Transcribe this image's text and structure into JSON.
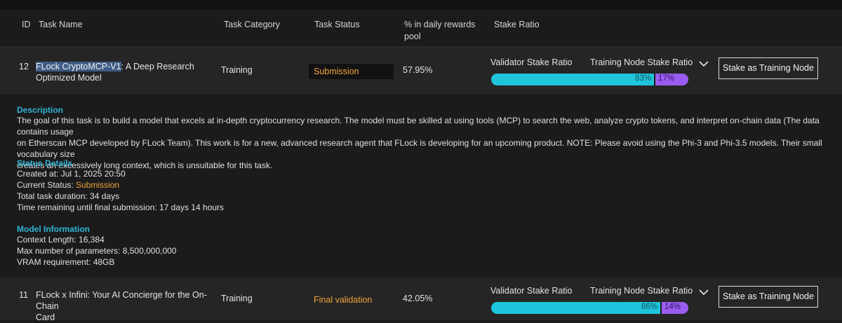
{
  "table": {
    "headers": {
      "id": "ID",
      "task_name": "Task Name",
      "task_category": "Task Category",
      "task_status": "Task Status",
      "rewards_line1": "% in daily rewards",
      "rewards_line2": "pool",
      "stake_ratio": "Stake Ratio"
    }
  },
  "rows": [
    {
      "id": "12",
      "name_selected": "FLock CryptoMCP-V1",
      "name_rest": ": A Deep Research",
      "name_line2": "Optimized Model",
      "category": "Training",
      "status": "Submission",
      "reward": "57.95%",
      "validator_label": "Validator Stake Ratio",
      "training_label": "Training Node Stake Ratio",
      "validator_pct_label": "83%",
      "training_pct_label": "17%",
      "validator_fraction": 0.83,
      "training_fraction": 0.17,
      "button": "Stake as Training Node"
    },
    {
      "id": "11",
      "name_line1": "FLock x Infini: Your AI Concierge for the On-Chain",
      "name_line2": "Card",
      "category": "Training",
      "status": "Final validation",
      "reward": "42.05%",
      "validator_label": "Validator Stake Ratio",
      "training_label": "Training Node Stake Ratio",
      "validator_pct_label": "86%",
      "training_pct_label": "14%",
      "validator_fraction": 0.86,
      "training_fraction": 0.14,
      "button": "Stake as Training Node"
    }
  ],
  "details": {
    "description_title": "Description",
    "description_lines": [
      "The goal of this task is to build a model that excels at in-depth cryptocurrency research. The model must be skilled at using tools (MCP) to search the web, analyze crypto tokens, and interpret on-chain data (The data contains usage",
      "on Etherscan MCP developed by FLock Team). This work is for a new, advanced research agent that FLock is developing for an upcoming product. NOTE: Please avoid using the Phi-3 and Phi-3.5 models. Their small vocabulary size",
      "creates an excessively long context, which is unsuitable for this task."
    ],
    "status_title": "Status Details",
    "created_at": "Created at: Jul 1, 2025 20:50",
    "current_status_label": "Current Status: ",
    "current_status_value": "Submission",
    "total_duration": "Total task duration: 34 days",
    "time_remaining": "Time remaining until final submission: 17 days 14 hours",
    "model_title": "Model Information",
    "context_length": "Context Length: 16,384",
    "max_params": "Max number of parameters: 8,500,000,000",
    "vram": "VRAM requirement: 48GB"
  },
  "colors": {
    "validator_bar": "#1ec5dc",
    "training_bar": "#9a5cf0",
    "status_orange": "#f2a33c",
    "section_title": "#2fb3d4"
  },
  "icons": [
    "chevron-down-icon"
  ]
}
